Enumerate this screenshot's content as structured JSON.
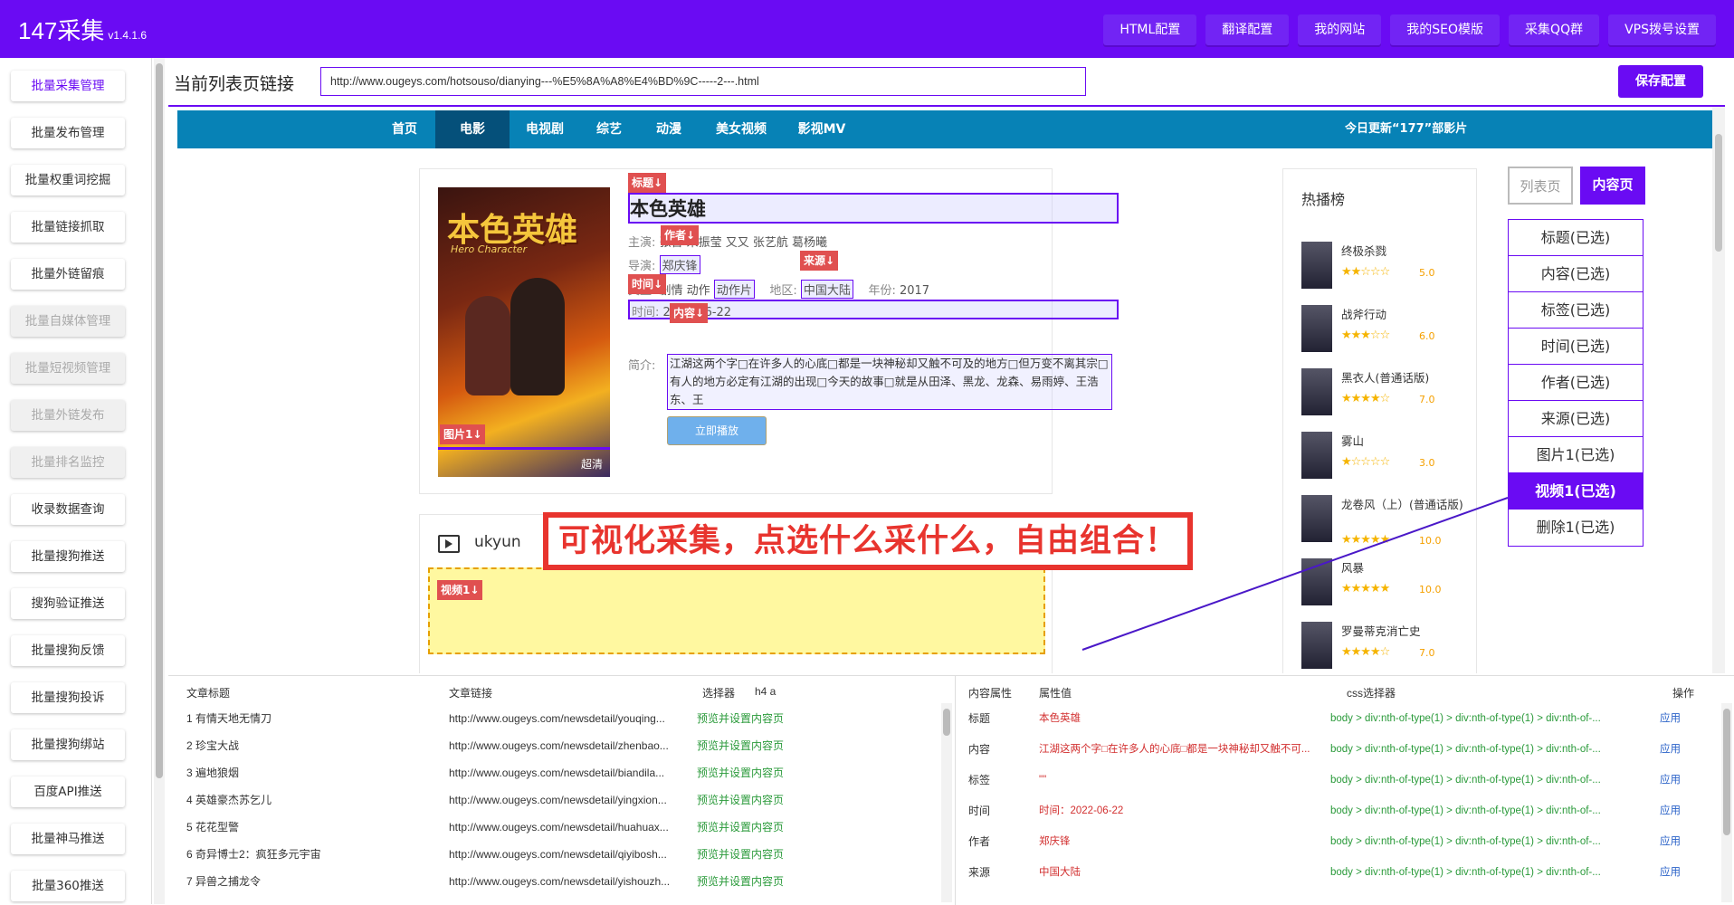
{
  "app": {
    "brand": "147采集",
    "version": "v1.4.1.6"
  },
  "topnav": [
    "HTML配置",
    "翻译配置",
    "我的网站",
    "我的SEO模版",
    "采集QQ群",
    "VPS拨号设置"
  ],
  "sidebar": [
    {
      "label": "批量采集管理",
      "state": "active"
    },
    {
      "label": "批量发布管理",
      "state": "normal"
    },
    {
      "label": "批量权重词挖掘",
      "state": "normal"
    },
    {
      "label": "批量链接抓取",
      "state": "normal"
    },
    {
      "label": "批量外链留痕",
      "state": "normal"
    },
    {
      "label": "批量自媒体管理",
      "state": "disabled"
    },
    {
      "label": "批量短视频管理",
      "state": "disabled"
    },
    {
      "label": "批量外链发布",
      "state": "disabled"
    },
    {
      "label": "批量排名监控",
      "state": "disabled"
    },
    {
      "label": "收录数据查询",
      "state": "normal"
    },
    {
      "label": "批量搜狗推送",
      "state": "normal"
    },
    {
      "label": "搜狗验证推送",
      "state": "normal"
    },
    {
      "label": "批量搜狗反馈",
      "state": "normal"
    },
    {
      "label": "批量搜狗投诉",
      "state": "normal"
    },
    {
      "label": "批量搜狗绑站",
      "state": "normal"
    },
    {
      "label": "百度API推送",
      "state": "normal"
    },
    {
      "label": "批量神马推送",
      "state": "normal"
    },
    {
      "label": "批量360推送",
      "state": "normal"
    }
  ],
  "urlbar": {
    "label": "当前列表页链接",
    "value": "http://www.ougeys.com/hotsouso/dianying---%E5%8A%A8%E4%BD%9C-----2---.html",
    "save": "保存配置"
  },
  "site": {
    "nav": [
      "首页",
      "电影",
      "电视剧",
      "综艺",
      "动漫",
      "美女视频",
      "影视MV"
    ],
    "update": "今日更新“177”部影片",
    "poster_title": "本色英雄",
    "poster_sub": "Hero Character",
    "hd": "超清",
    "movie_title": "本色英雄",
    "cast_label": "主演:",
    "cast": "张晋 宋振莹 又又 张艺航 葛杨曦",
    "director_label": "导演:",
    "director": "郑庆锋",
    "genre_label": "类型:",
    "genre": "剧情 动作",
    "genre2": "动作片",
    "region_label": "地区:",
    "region": "中国大陆",
    "year_label": "年份:",
    "year": "2017",
    "time_label": "时间:",
    "time": "2022-06-22",
    "desc_label": "简介:",
    "desc": "江湖这两个字□在许多人的心底□都是一块神秘却又触不可及的地方□但万变不离其宗□有人的地方必定有江湖的出现□今天的故事□就是从田泽、黑龙、龙森、易雨婷、王浩东、王",
    "play": "立即播放",
    "hot_title": "热播榜",
    "hot": [
      {
        "name": "终极杀戮",
        "stars": "★★☆☆☆",
        "score": "5.0"
      },
      {
        "name": "战斧行动",
        "stars": "★★★☆☆",
        "score": "6.0"
      },
      {
        "name": "黑衣人(普通话版)",
        "stars": "★★★★☆",
        "score": "7.0"
      },
      {
        "name": "雾山",
        "stars": "★☆☆☆☆",
        "score": "3.0"
      },
      {
        "name": "龙卷风（上）(普通话版)",
        "stars": "★★★★★",
        "score": "10.0"
      },
      {
        "name": "风暴",
        "stars": "★★★★★",
        "score": "10.0"
      },
      {
        "name": "罗曼蒂克消亡史",
        "stars": "★★★★☆",
        "score": "7.0"
      }
    ],
    "video_label": "ukyun"
  },
  "tags": {
    "title": "标题↓",
    "author": "作者↓",
    "source": "来源↓",
    "time": "时间↓",
    "content": "内容↓",
    "image": "图片1↓",
    "video": "视频1↓"
  },
  "banner": "可视化采集，点选什么采什么，自由组合！",
  "typebtns": [
    "列表页",
    "内容页"
  ],
  "fields": [
    {
      "label": "标题(已选)",
      "on": false
    },
    {
      "label": "内容(已选)",
      "on": false
    },
    {
      "label": "标签(已选)",
      "on": false
    },
    {
      "label": "时间(已选)",
      "on": false
    },
    {
      "label": "作者(已选)",
      "on": false
    },
    {
      "label": "来源(已选)",
      "on": false
    },
    {
      "label": "图片1(已选)",
      "on": false
    },
    {
      "label": "视频1(已选)",
      "on": true
    },
    {
      "label": "删除1(已选)",
      "on": false
    }
  ],
  "list_table": {
    "headers": {
      "title": "文章标题",
      "link": "文章链接",
      "selector": "选择器",
      "selector_value": "h4 a"
    },
    "action": "预览并设置内容页",
    "rows": [
      {
        "title": "1 有情天地无情刀",
        "link": "http://www.ougeys.com/newsdetail/youqing..."
      },
      {
        "title": "2 珍宝大战",
        "link": "http://www.ougeys.com/newsdetail/zhenbao..."
      },
      {
        "title": "3 遍地狼烟",
        "link": "http://www.ougeys.com/newsdetail/biandila..."
      },
      {
        "title": "4 英雄豪杰苏乞儿",
        "link": "http://www.ougeys.com/newsdetail/yingxion..."
      },
      {
        "title": "5 花花型警",
        "link": "http://www.ougeys.com/newsdetail/huahuax..."
      },
      {
        "title": "6 奇异博士2：疯狂多元宇宙",
        "link": "http://www.ougeys.com/newsdetail/qiyibosh..."
      },
      {
        "title": "7 异兽之捕龙令",
        "link": "http://www.ougeys.com/newsdetail/yishouzh..."
      }
    ]
  },
  "attr_table": {
    "headers": {
      "attr": "内容属性",
      "value": "属性值",
      "css": "css选择器",
      "op": "操作"
    },
    "apply": "应用",
    "rows": [
      {
        "attr": "标题",
        "value": "本色英雄",
        "css": "body > div:nth-of-type(1) > div:nth-of-type(1) > div:nth-of-..."
      },
      {
        "attr": "内容",
        "value": "江湖这两个字□在许多人的心底□都是一块神秘却又触不可...",
        "css": "body > div:nth-of-type(1) > div:nth-of-type(1) > div:nth-of-..."
      },
      {
        "attr": "标签",
        "value": "\"\"",
        "css": "body > div:nth-of-type(1) > div:nth-of-type(1) > div:nth-of-..."
      },
      {
        "attr": "时间",
        "value": "时间：2022-06-22",
        "css": "body > div:nth-of-type(1) > div:nth-of-type(1) > div:nth-of-..."
      },
      {
        "attr": "作者",
        "value": "郑庆锋",
        "css": "body > div:nth-of-type(1) > div:nth-of-type(1) > div:nth-of-..."
      },
      {
        "attr": "来源",
        "value": "中国大陆",
        "css": "body > div:nth-of-type(1) > div:nth-of-type(1) > div:nth-of-..."
      }
    ]
  }
}
